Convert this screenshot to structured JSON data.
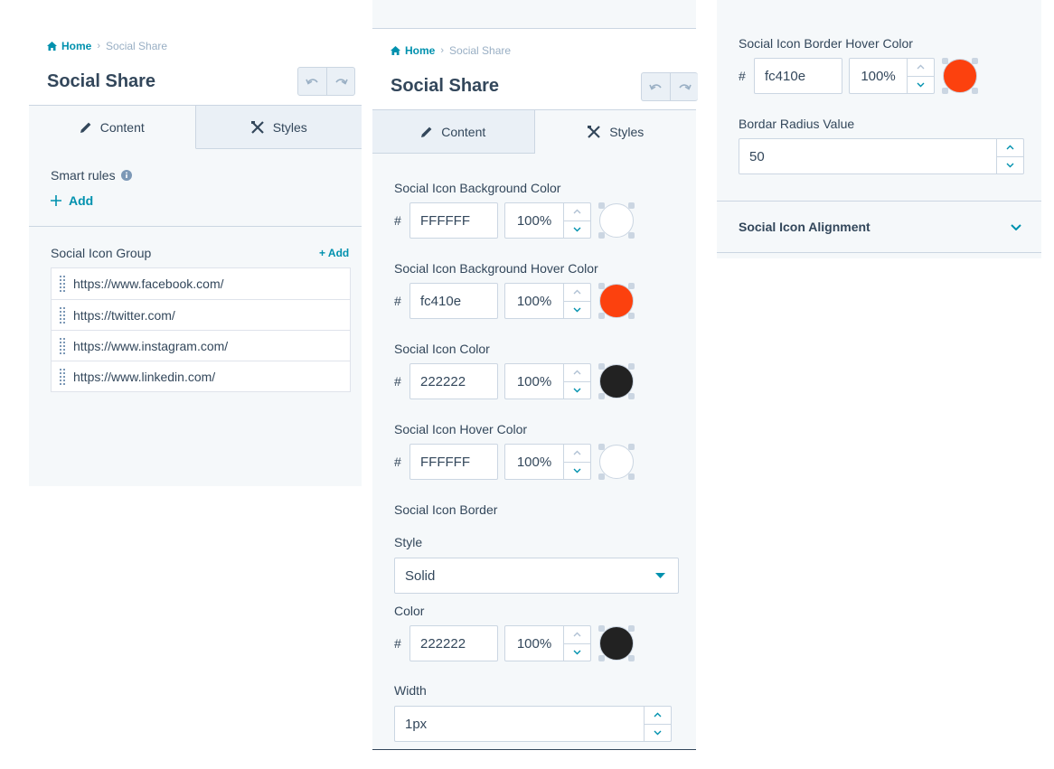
{
  "panel1": {
    "breadcrumb": {
      "home": "Home",
      "current": "Social Share"
    },
    "title": "Social Share",
    "tabs": {
      "content": "Content",
      "styles": "Styles"
    },
    "smart_rules": {
      "label": "Smart rules",
      "add": "Add"
    },
    "group": {
      "label": "Social Icon Group",
      "add": "+ Add",
      "items": [
        {
          "url": "https://www.facebook.com/"
        },
        {
          "url": "https://twitter.com/"
        },
        {
          "url": "https://www.instagram.com/"
        },
        {
          "url": "https://www.linkedin.com/"
        }
      ]
    }
  },
  "panel2": {
    "breadcrumb": {
      "home": "Home",
      "current": "Social Share"
    },
    "title": "Social Share",
    "tabs": {
      "content": "Content",
      "styles": "Styles"
    },
    "colors": [
      {
        "label": "Social Icon Background Color",
        "hex": "FFFFFF",
        "opacity": "100%",
        "swatch": "#ffffff"
      },
      {
        "label": "Social Icon Background Hover Color",
        "hex": "fc410e",
        "opacity": "100%",
        "swatch": "#fc410e"
      },
      {
        "label": "Social Icon Color",
        "hex": "222222",
        "opacity": "100%",
        "swatch": "#222222"
      },
      {
        "label": "Social Icon Hover Color",
        "hex": "FFFFFF",
        "opacity": "100%",
        "swatch": "#ffffff"
      }
    ],
    "border": {
      "heading": "Social Icon Border",
      "style_label": "Style",
      "style_value": "Solid",
      "color_label": "Color",
      "color": {
        "hex": "222222",
        "opacity": "100%",
        "swatch": "#222222"
      },
      "width_label": "Width",
      "width_value": "1px"
    }
  },
  "panel3": {
    "hover_border": {
      "label": "Social Icon Border Hover Color",
      "hex": "fc410e",
      "opacity": "100%",
      "swatch": "#fc410e"
    },
    "radius": {
      "label": "Bordar Radius Value",
      "value": "50"
    },
    "alignment": {
      "label": "Social Icon Alignment"
    }
  },
  "colors": {
    "accent": "#0091ae",
    "text": "#33475b",
    "border": "#cbd6e2",
    "panel_bg": "#f5f8fa"
  }
}
